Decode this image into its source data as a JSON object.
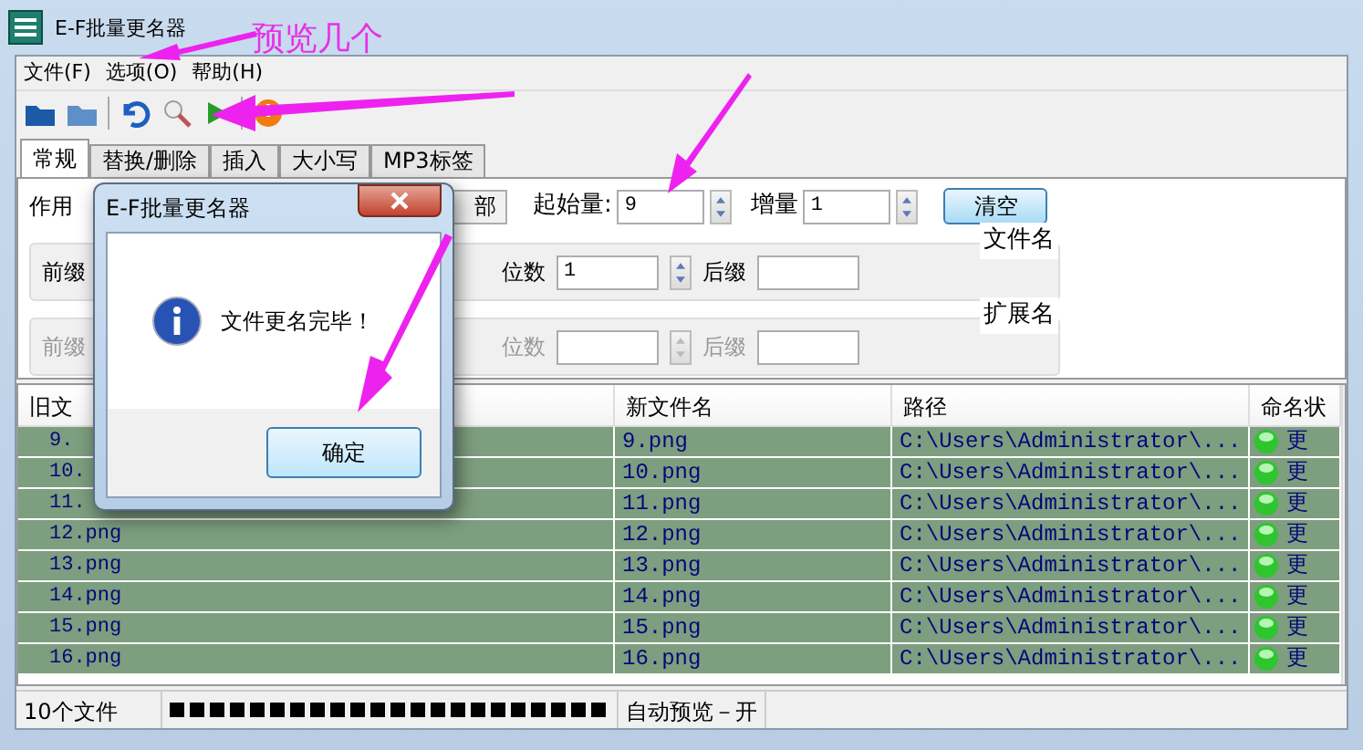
{
  "window": {
    "title": "E-F批量更名器"
  },
  "annotation": {
    "text": "预览几个"
  },
  "menu": [
    {
      "label": "文件(F)"
    },
    {
      "label": "选项(O)"
    },
    {
      "label": "帮助(H)"
    }
  ],
  "tabs": [
    {
      "label": "常规",
      "selected": true
    },
    {
      "label": "替换/删除",
      "selected": false
    },
    {
      "label": "插入",
      "selected": false
    },
    {
      "label": "大小写",
      "selected": false
    },
    {
      "label": "MP3标签",
      "selected": false
    }
  ],
  "options": {
    "apply_label": "作用",
    "apply_value": "部",
    "start_label": "起始量:",
    "start_value": "9",
    "step_label": "增量",
    "step_value": "1",
    "clear_button": "清空"
  },
  "groups": [
    {
      "title": "文件名",
      "disabled": false,
      "prefix_label": "前缀",
      "digits_label": "位数",
      "digits_value": "1",
      "suffix_label": "后缀"
    },
    {
      "title": "扩展名",
      "disabled": true,
      "prefix_label": "前缀",
      "digits_label": "位数",
      "suffix_label": "后缀"
    }
  ],
  "table": {
    "columns": [
      "旧文",
      "新文件名",
      "路径",
      "命名状"
    ],
    "rows": [
      {
        "old": "9.",
        "new": "9.png",
        "path": "C:\\Users\\Administrator\\...",
        "status": "更",
        "selected": true
      },
      {
        "old": "10.",
        "new": "10.png",
        "path": "C:\\Users\\Administrator\\...",
        "status": "更",
        "selected": true
      },
      {
        "old": "11.",
        "new": "11.png",
        "path": "C:\\Users\\Administrator\\...",
        "status": "更",
        "selected": true
      },
      {
        "old": "12.png",
        "new": "12.png",
        "path": "C:\\Users\\Administrator\\...",
        "status": "更",
        "selected": true
      },
      {
        "old": "13.png",
        "new": "13.png",
        "path": "C:\\Users\\Administrator\\...",
        "status": "更",
        "selected": true
      },
      {
        "old": "14.png",
        "new": "14.png",
        "path": "C:\\Users\\Administrator\\...",
        "status": "更",
        "selected": true
      },
      {
        "old": "15.png",
        "new": "15.png",
        "path": "C:\\Users\\Administrator\\...",
        "status": "更",
        "selected": true
      },
      {
        "old": "16.png",
        "new": "16.png",
        "path": "C:\\Users\\Administrator\\...",
        "status": "更",
        "selected": true
      }
    ]
  },
  "status_bar": {
    "count": "10个文件",
    "progress": {
      "level": 1
    },
    "preview": "自动预览－开"
  },
  "dialog": {
    "title": "E-F批量更名器",
    "message": "文件更名完毕！",
    "button": "确定"
  }
}
